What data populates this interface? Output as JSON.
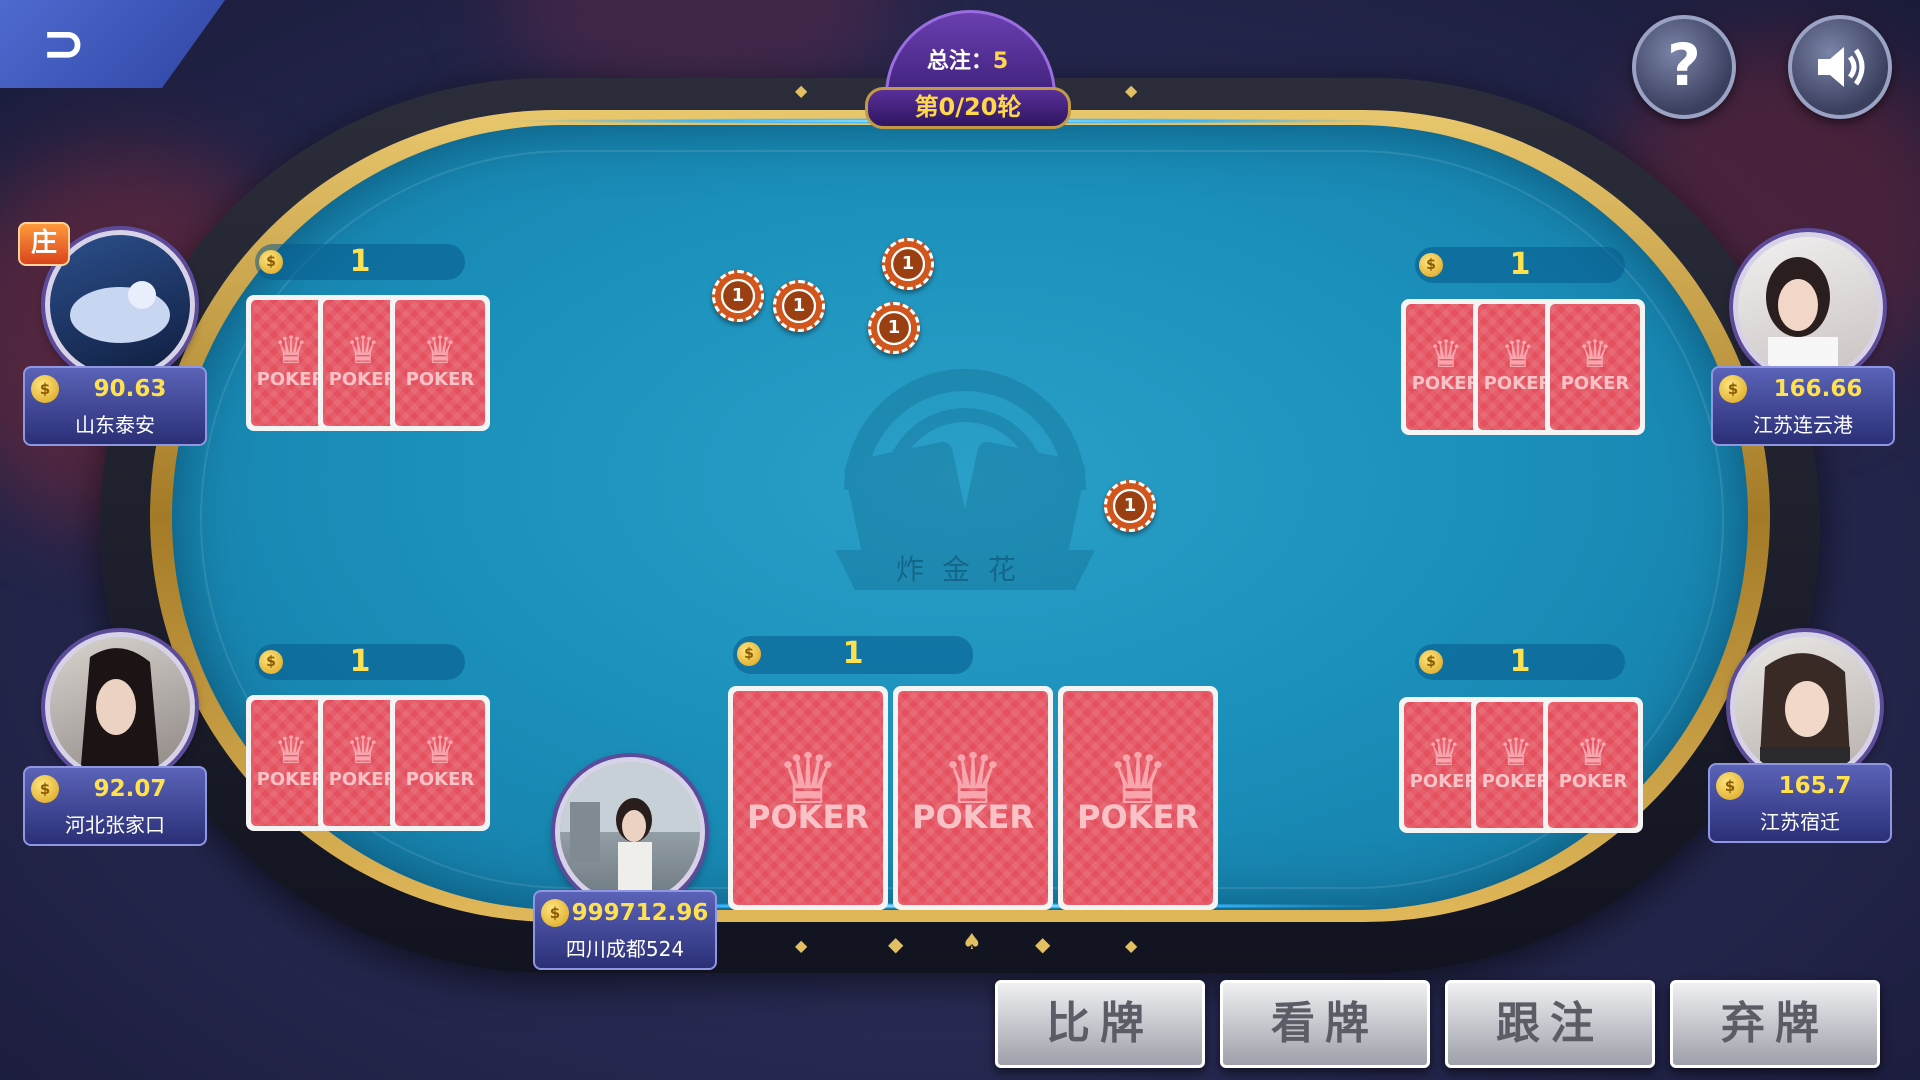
{
  "header": {
    "pot_label": "总注：",
    "pot_value": "5",
    "round_text": "第0/20轮"
  },
  "table_logo_text": "炸金花",
  "icons": {
    "back": "back-arrow-icon",
    "help": "question-icon",
    "sound": "speaker-icon"
  },
  "players": [
    {
      "name": "山东泰安",
      "money": "90.63",
      "bet": "1",
      "dealer_badge": "庄"
    },
    {
      "name": "江苏连云港",
      "money": "166.66",
      "bet": "1"
    },
    {
      "name": "河北张家口",
      "money": "92.07",
      "bet": "1"
    },
    {
      "name": "江苏宿迁",
      "money": "165.7",
      "bet": "1"
    },
    {
      "name": "四川成都524",
      "money": "999712.96",
      "bet": "1"
    }
  ],
  "card_back_text": "POKER",
  "chips": [
    "1",
    "1",
    "1",
    "1",
    "1"
  ],
  "actions": {
    "compare": "比牌",
    "look": "看牌",
    "follow": "跟注",
    "fold": "弃牌"
  },
  "colors": {
    "felt": "#1a8fba",
    "gold": "#e0b85a",
    "card": "#e4505e",
    "accent_yellow": "#ffe14f"
  }
}
